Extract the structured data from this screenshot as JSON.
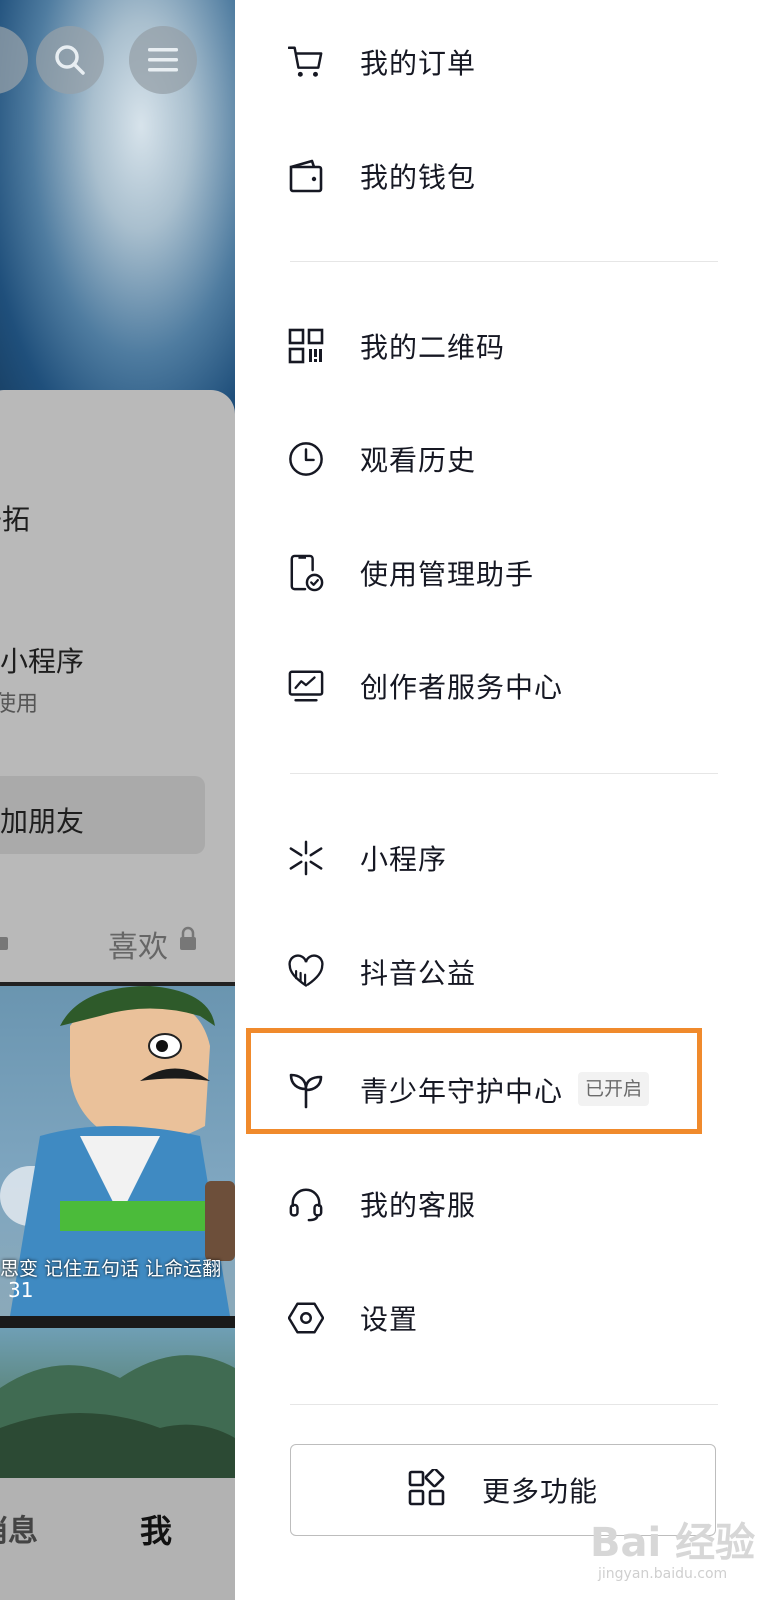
{
  "background_page": {
    "partial_texts": [
      "开拓",
      "小程序",
      "使用",
      "加朋友",
      "喜欢",
      "思变 记住五句话 让命运翻",
      "31"
    ],
    "tabbar": {
      "messages_partial": "消息",
      "me": "我"
    }
  },
  "drawer": {
    "items": [
      {
        "label": "我的订单",
        "icon": "cart-icon"
      },
      {
        "label": "我的钱包",
        "icon": "wallet-icon"
      },
      {
        "label": "我的二维码",
        "icon": "qrcode-icon"
      },
      {
        "label": "观看历史",
        "icon": "clock-icon"
      },
      {
        "label": "使用管理助手",
        "icon": "phone-check-icon"
      },
      {
        "label": "创作者服务中心",
        "icon": "monitor-chart-icon"
      },
      {
        "label": "小程序",
        "icon": "mini-program-icon"
      },
      {
        "label": "抖音公益",
        "icon": "heart-charity-icon"
      },
      {
        "label": "青少年守护中心",
        "icon": "sprout-icon",
        "badge": "已开启"
      },
      {
        "label": "我的客服",
        "icon": "headset-icon"
      },
      {
        "label": "设置",
        "icon": "hexagon-settings-icon"
      }
    ],
    "more_button": {
      "label": "更多功能",
      "icon": "grid-apps-icon"
    }
  },
  "watermark": {
    "text": "Bai 经验",
    "sub": "jingyan.baidu.com"
  },
  "colors": {
    "highlight": "#f08a2c",
    "text": "#161823",
    "divider": "#e6e6e6",
    "dim_overlay": "#b5b5b5"
  }
}
